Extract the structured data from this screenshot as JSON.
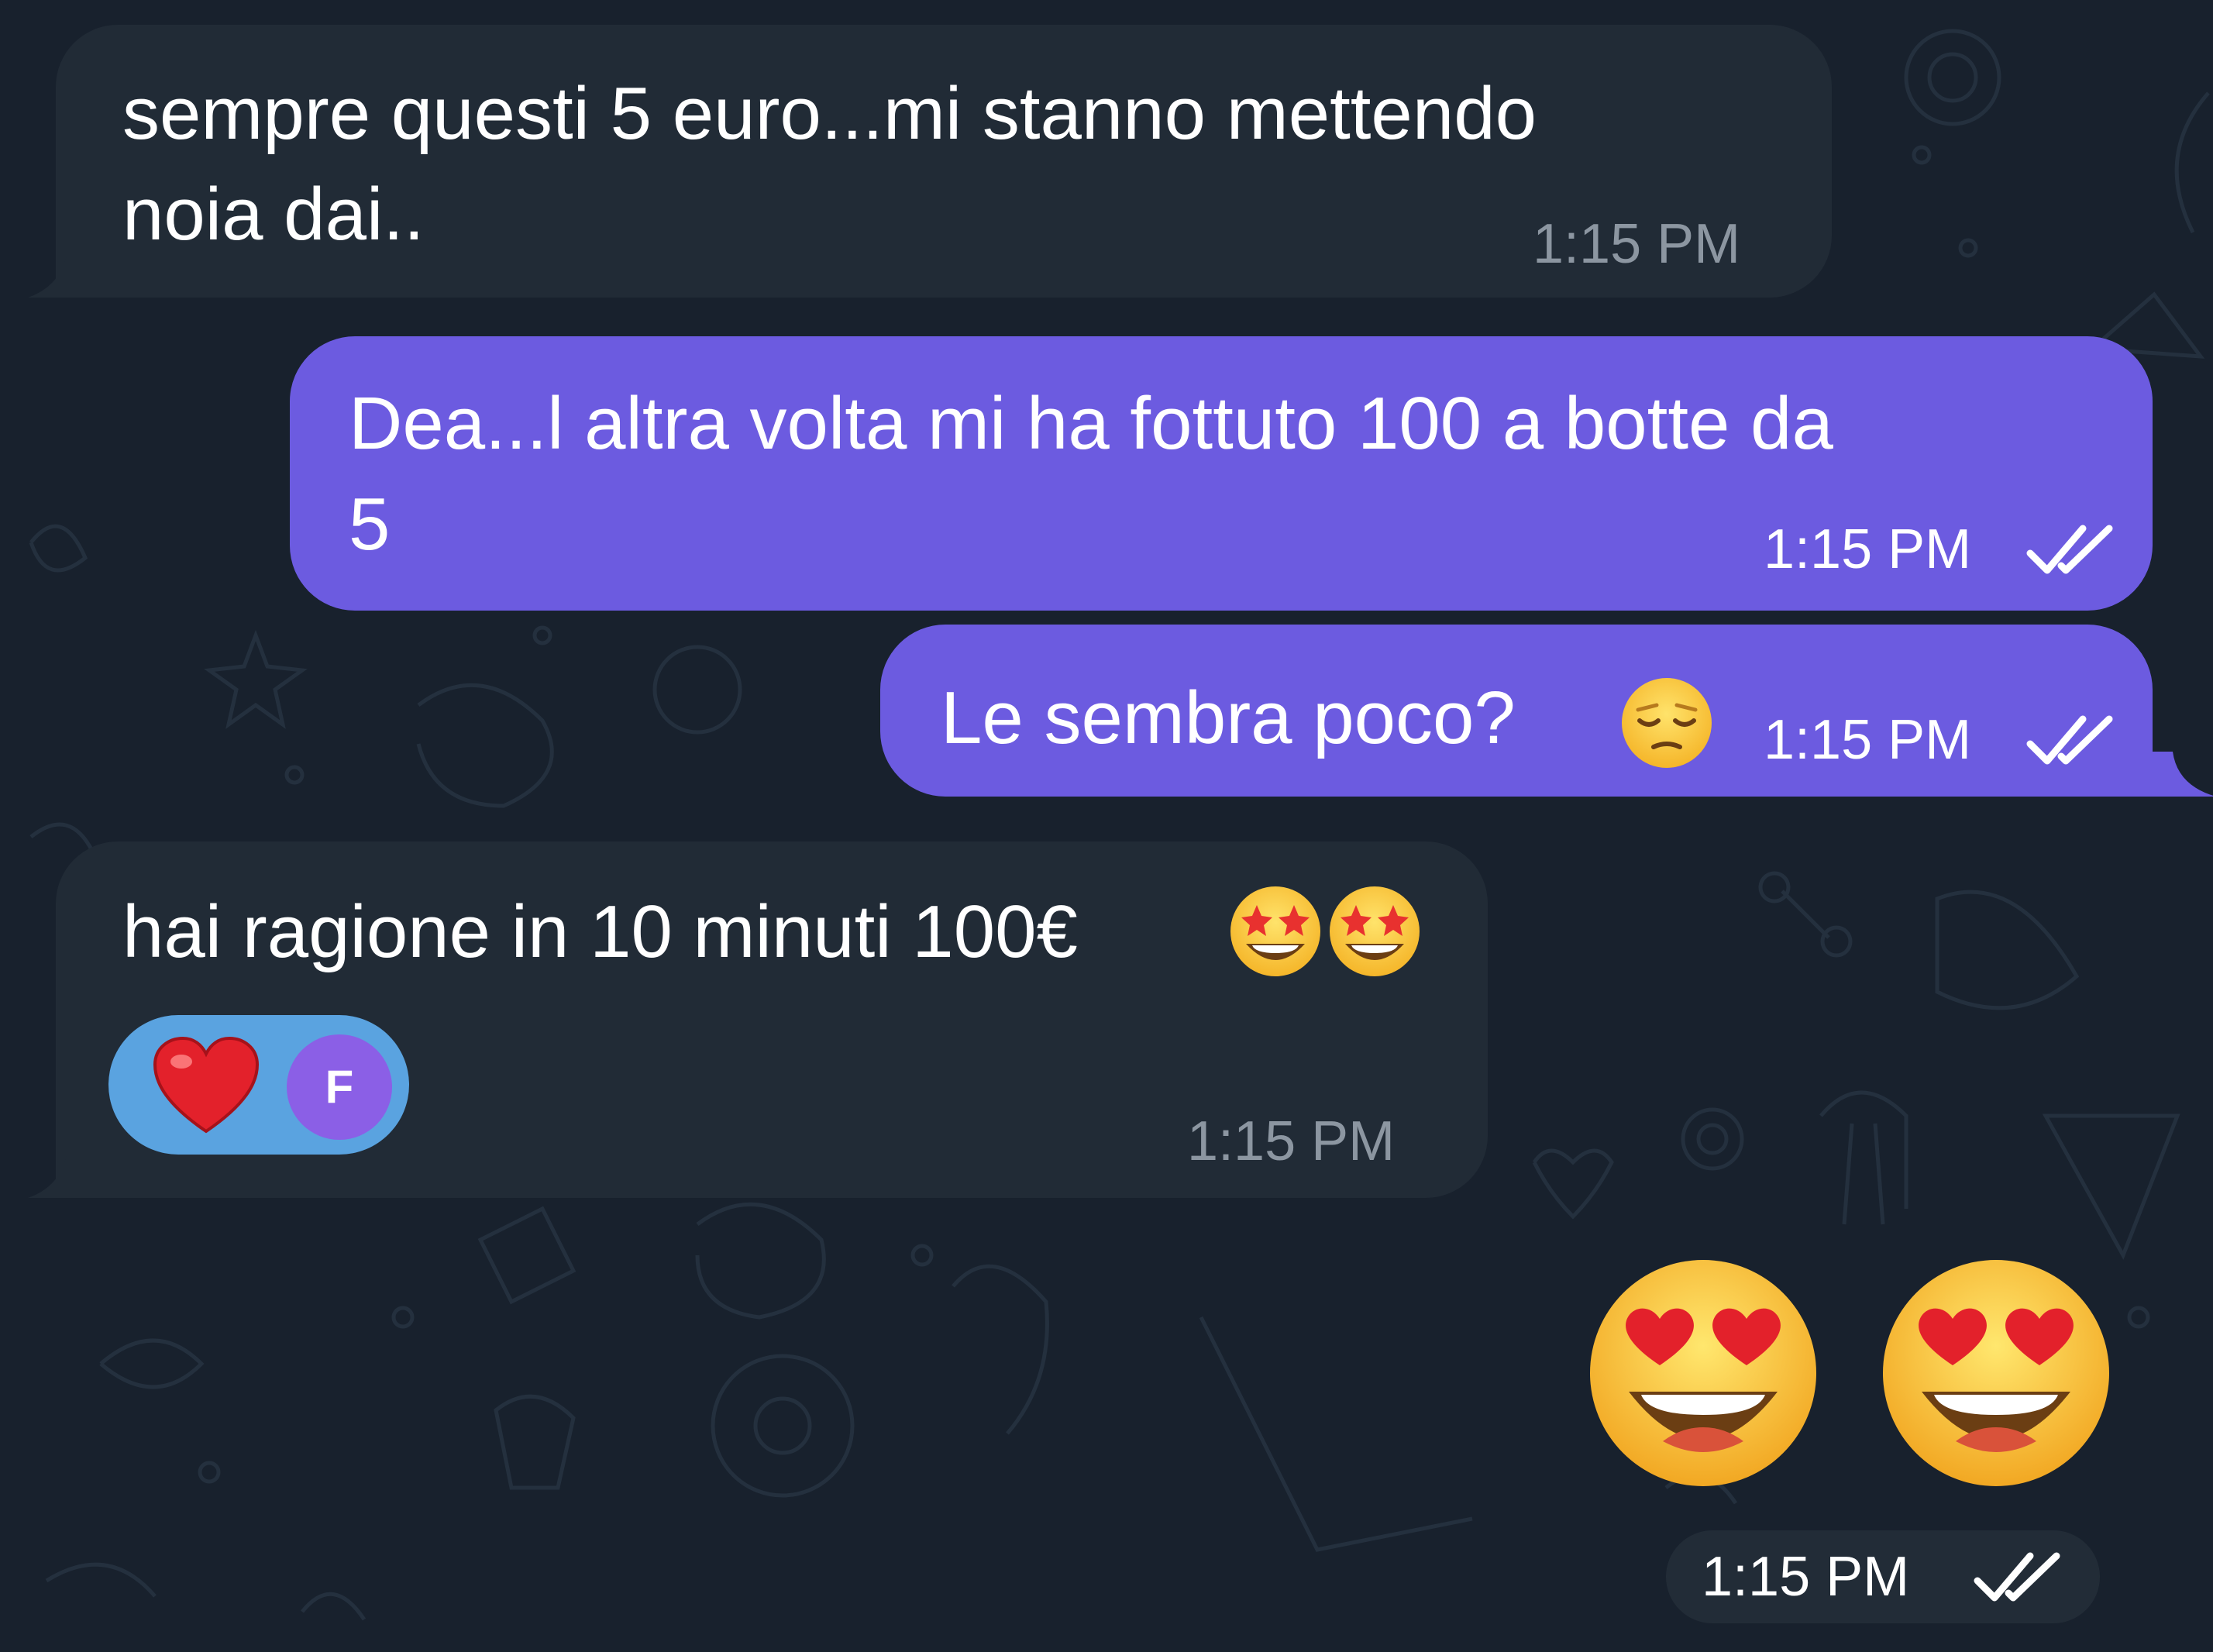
{
  "messages": [
    {
      "direction": "incoming",
      "line1": "sempre questi 5 euro...mi stanno mettendo",
      "line2": "noia dai..",
      "time": "1:15 PM"
    },
    {
      "direction": "outgoing",
      "line1": "Dea...l altra volta mi ha fottuto 100 a botte da",
      "line2": "5",
      "time": "1:15 PM",
      "status": "read"
    },
    {
      "direction": "outgoing",
      "text": "Le sembra poco?",
      "emoji": "pensive-face",
      "time": "1:15 PM",
      "status": "read"
    },
    {
      "direction": "incoming",
      "text": "hai ragione in 10 minuti 100€",
      "emoji": [
        "star-struck",
        "star-struck"
      ],
      "reaction": {
        "emoji": "red-heart",
        "reactor_initial": "F"
      },
      "time": "1:15 PM"
    },
    {
      "direction": "outgoing",
      "sticker_emoji": [
        "heart-eyes",
        "heart-eyes"
      ],
      "time": "1:15 PM",
      "status": "read"
    }
  ],
  "colors": {
    "background": "#18212d",
    "incoming_bubble": "#212b36",
    "outgoing_bubble": "#6c5be0",
    "reaction_chip": "#5aa3e0",
    "reaction_avatar": "#8b5fe6",
    "incoming_time": "#8c96a1"
  }
}
